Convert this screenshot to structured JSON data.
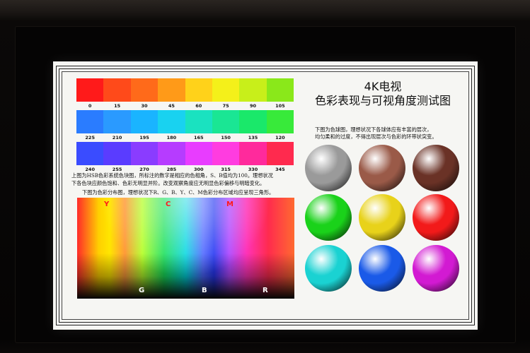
{
  "screen": {
    "title_line1": "4K电视",
    "title_line2": "色彩表现与可视角度测试图",
    "hue_rows": [
      {
        "colors": [
          "#ff1a1a",
          "#ff4a1a",
          "#ff6a1a",
          "#ff9a18",
          "#ffd21a",
          "#f4f01a",
          "#c8ef1a",
          "#8ae81a"
        ],
        "labels": [
          "0",
          "15",
          "30",
          "45",
          "60",
          "75",
          "90",
          "105"
        ]
      },
      {
        "colors": [
          "#2a7cff",
          "#2a9aff",
          "#1ab4ff",
          "#19d2f0",
          "#1ae2c0",
          "#1ae694",
          "#1ae86a",
          "#38ea3a"
        ],
        "labels": [
          "225",
          "210",
          "195",
          "180",
          "165",
          "150",
          "135",
          "120"
        ]
      },
      {
        "colors": [
          "#3a4cff",
          "#5a3cff",
          "#8a3cff",
          "#b63cff",
          "#e83cff",
          "#ff3ce0",
          "#ff2a9c",
          "#ff2a4e"
        ],
        "labels": [
          "240",
          "255",
          "270",
          "285",
          "300",
          "315",
          "330",
          "345"
        ]
      }
    ],
    "hsb_note_line1": "上图为HSB色彩系统色块图，所标注的数字是相应的色相角，S、B值均为100。理想状况",
    "hsb_note_line2": "下各色块应颜色饱和、色彩无明显并阶。改变观察角度应无明显色彩偏移与明暗变化。",
    "gamut_note": "下图为色彩分布图，理想状况下R、G、B、Y、C、M色彩分布区域均应呈现三角形。",
    "gamut_top_labels": [
      "Y",
      "C",
      "M"
    ],
    "gamut_bottom_labels": [
      "G",
      "B",
      "R"
    ],
    "sphere_note_line1": "下图为色球图，理想状况下各球体应有丰富的层次，",
    "sphere_note_line2": "均匀柔和的过度，不得出现层次与色彩的环带状突变。",
    "spheres": [
      {
        "name": "gray",
        "color": "#9a9a9a"
      },
      {
        "name": "skin",
        "color": "#9a5a48"
      },
      {
        "name": "brown",
        "color": "#6a3226"
      },
      {
        "name": "green",
        "color": "#1ad21a"
      },
      {
        "name": "yellow",
        "color": "#e8d21a"
      },
      {
        "name": "red",
        "color": "#f21a1a"
      },
      {
        "name": "cyan",
        "color": "#1ad2d2"
      },
      {
        "name": "blue",
        "color": "#1a5ae8"
      },
      {
        "name": "magenta",
        "color": "#d21ad2"
      }
    ]
  }
}
